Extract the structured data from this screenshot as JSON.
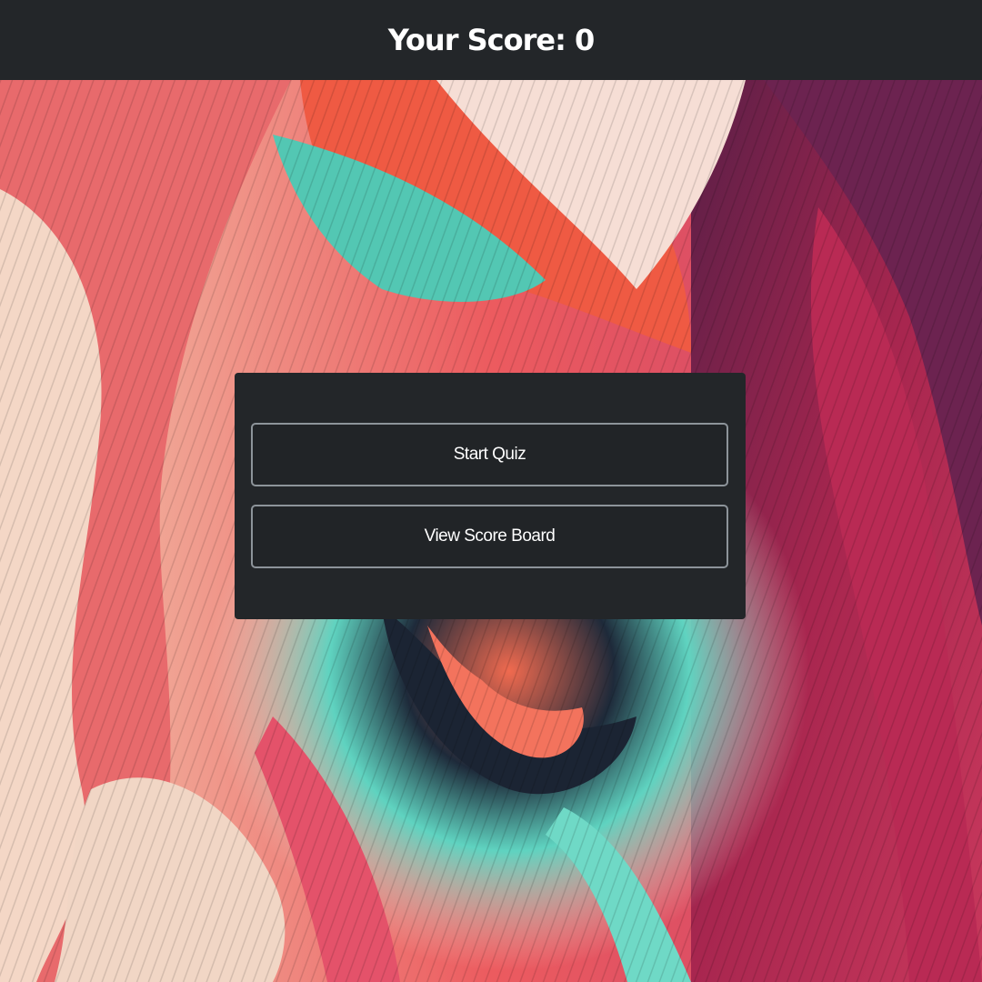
{
  "header": {
    "title": "Your Score: 0"
  },
  "menu": {
    "start_label": "Start Quiz",
    "scoreboard_label": "View Score Board"
  },
  "colors": {
    "bar": "#232629",
    "panel": "#232629",
    "button_border": "#8d949a",
    "text": "#ffffff"
  }
}
